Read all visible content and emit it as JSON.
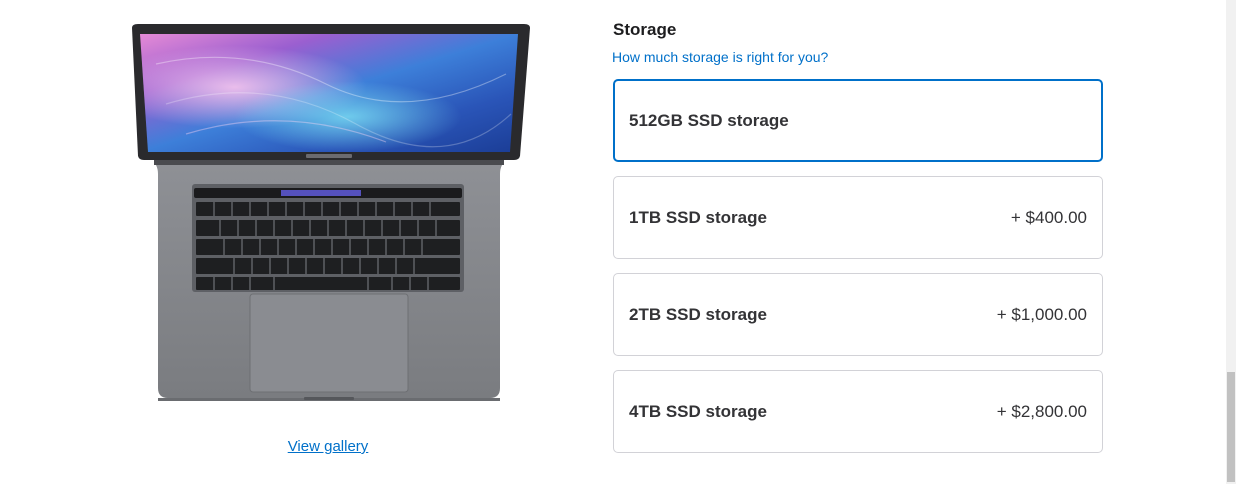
{
  "gallery": {
    "link_label": "View gallery"
  },
  "storage": {
    "title": "Storage",
    "help_link": "How much storage is right for you?",
    "options": [
      {
        "label": "512GB SSD storage",
        "price": "",
        "selected": true
      },
      {
        "label": "1TB SSD storage",
        "price": "+ $400.00",
        "selected": false
      },
      {
        "label": "2TB SSD storage",
        "price": "+ $1,000.00",
        "selected": false
      },
      {
        "label": "4TB SSD storage",
        "price": "+ $2,800.00",
        "selected": false
      }
    ]
  },
  "colors": {
    "accent": "#0070c9",
    "border": "#d2d2d7",
    "text": "#1d1d1f"
  }
}
